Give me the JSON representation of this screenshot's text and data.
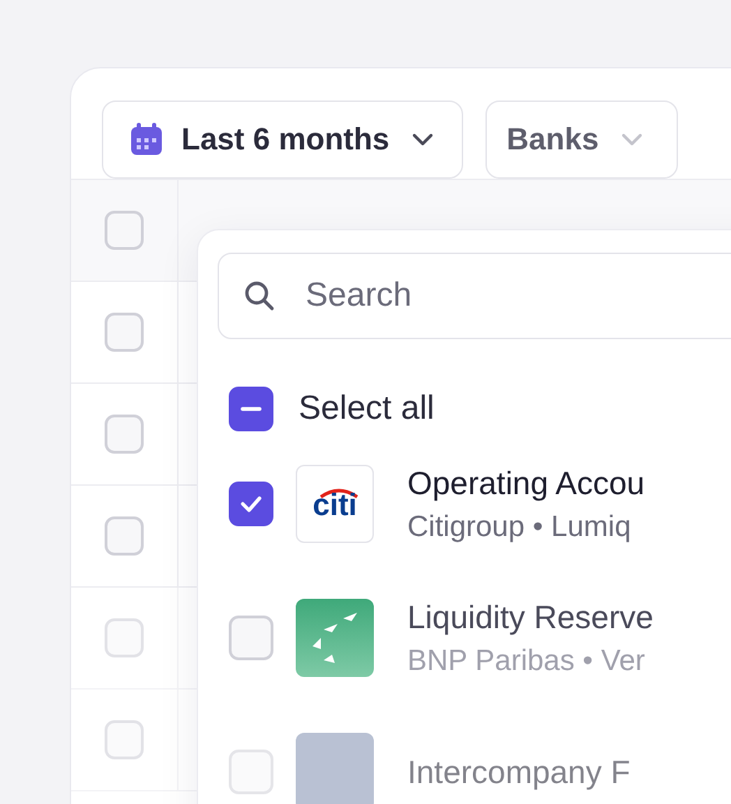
{
  "filters": [
    {
      "kind": "date",
      "label": "Last 6 months"
    },
    {
      "kind": "plain",
      "label": "Banks"
    }
  ],
  "table": {
    "rows": [
      {
        "checked": false
      },
      {
        "checked": false
      },
      {
        "checked": false
      },
      {
        "checked": false
      },
      {
        "checked": false
      },
      {
        "checked": false
      }
    ]
  },
  "dropdown": {
    "search": {
      "placeholder": "Search"
    },
    "select_all": {
      "label": "Select all",
      "indeterminate": true
    },
    "options": [
      {
        "checked": true,
        "name": "Operating Accou",
        "detail": "Citigroup • Lumiq",
        "logo": {
          "kind": "wordmark",
          "text": "citi"
        }
      },
      {
        "checked": false,
        "name": "Liquidity Reserve",
        "detail": "BNP Paribas • Ver",
        "logo": {
          "kind": "stars"
        }
      },
      {
        "checked": false,
        "name": "Intercompany F",
        "logo": {
          "kind": "blank"
        }
      }
    ]
  }
}
